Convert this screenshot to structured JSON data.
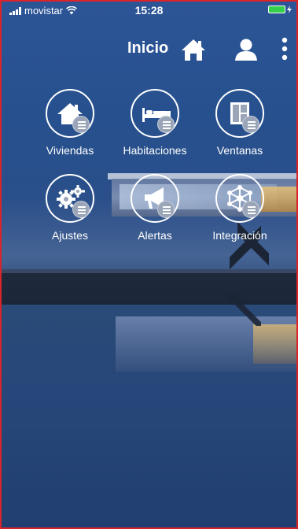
{
  "status": {
    "carrier": "movistar",
    "time": "15:28"
  },
  "header": {
    "title": "Inicio"
  },
  "tiles": [
    {
      "label": "Viviendas",
      "icon": "house-icon"
    },
    {
      "label": "Habitaciones",
      "icon": "bed-icon"
    },
    {
      "label": "Ventanas",
      "icon": "window-icon"
    },
    {
      "label": "Ajustes",
      "icon": "gears-icon"
    },
    {
      "label": "Alertas",
      "icon": "megaphone-icon"
    },
    {
      "label": "Integración",
      "icon": "network-icon"
    }
  ],
  "colors": {
    "border": "#d9252a",
    "battery": "#35d04a",
    "badge": "#9aa5b8"
  }
}
